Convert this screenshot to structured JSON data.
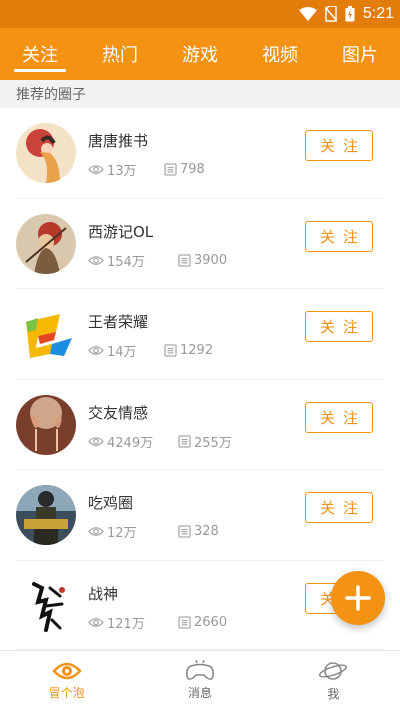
{
  "status_bar": {
    "time": "5:21",
    "icons": [
      "wifi-icon",
      "no-sim-icon",
      "battery-icon"
    ]
  },
  "tabs": [
    {
      "label": "关注",
      "active": true
    },
    {
      "label": "热门",
      "active": false
    },
    {
      "label": "游戏",
      "active": false
    },
    {
      "label": "视频",
      "active": false
    },
    {
      "label": "图片",
      "active": false
    }
  ],
  "section": {
    "title": "推荐的圈子"
  },
  "circles": [
    {
      "name": "唐唐推书",
      "views": "13万",
      "posts": "798",
      "follow_label": "关注"
    },
    {
      "name": "西游记OL",
      "views": "154万",
      "posts": "3900",
      "follow_label": "关注"
    },
    {
      "name": "王者荣耀",
      "views": "14万",
      "posts": "1292",
      "follow_label": "关注"
    },
    {
      "name": "交友情感",
      "views": "4249万",
      "posts": "255万",
      "follow_label": "关注"
    },
    {
      "name": "吃鸡圈",
      "views": "12万",
      "posts": "328",
      "follow_label": "关注"
    },
    {
      "name": "战神",
      "views": "121万",
      "posts": "2660",
      "follow_label": "关注"
    }
  ],
  "bottom_nav": [
    {
      "label": "冒个泡",
      "icon": "eye-icon",
      "active": true
    },
    {
      "label": "消息",
      "icon": "gamepad-icon",
      "active": false
    },
    {
      "label": "我",
      "icon": "planet-icon",
      "active": false
    }
  ],
  "colors": {
    "accent": "#f39213",
    "status_bar": "#e27d0c",
    "section_bg": "#f2f2f2"
  }
}
